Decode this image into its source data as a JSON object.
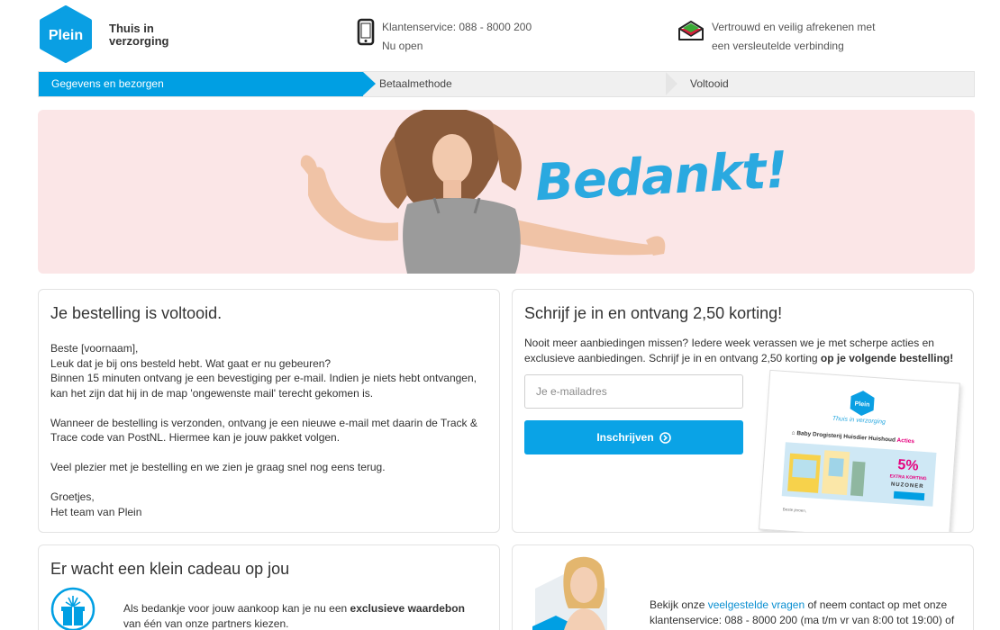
{
  "header": {
    "logo_text": "Plein",
    "tagline_line1": "Thuis in",
    "tagline_line2": "verzorging",
    "service_line1": "Klantenservice: 088 - 8000 200",
    "service_line2": "Nu open",
    "trust_line1": "Vertrouwd en veilig afrekenen met",
    "trust_line2": "een versleutelde verbinding"
  },
  "steps": [
    {
      "label": "Gegevens en bezorgen",
      "active": true
    },
    {
      "label": "Betaalmethode",
      "active": false
    },
    {
      "label": "Voltooid",
      "active": false
    }
  ],
  "banner": {
    "text": "Bedankt!"
  },
  "order_card": {
    "title": "Je bestelling is voltooid.",
    "greeting": "Beste [voornaam],",
    "line1": "Leuk dat je bij ons besteld hebt. Wat gaat er nu gebeuren?",
    "line2": "Binnen 15 minuten ontvang je een bevestiging per e-mail. Indien je niets hebt ontvangen,",
    "line3": "kan het zijn dat hij in de map 'ongewenste mail' terecht gekomen is.",
    "para2_line1": "Wanneer de bestelling is verzonden, ontvang je een nieuwe e-mail met daarin de Track &",
    "para2_line2": "Trace code van PostNL. Hiermee kan je jouw pakket volgen.",
    "para3": "Veel plezier met je bestelling en we zien je graag snel nog eens terug.",
    "closing1": "Groetjes,",
    "closing2": "Het team van Plein"
  },
  "newsletter_card": {
    "title": "Schrijf je in en ontvang 2,50 korting!",
    "desc_line1": "Nooit meer aanbiedingen missen? Iedere week verassen we je met scherpe acties en",
    "desc_line2_plain": "exclusieve aanbiedingen. Schrijf je in en ontvang 2,50 korting ",
    "desc_line2_bold": "op je volgende bestelling!",
    "email_placeholder": "Je e-mailadres",
    "subscribe_label": "Inschrijven",
    "preview": {
      "logo": "Plein",
      "tagline": "Thuis in verzorging",
      "nav": [
        "Baby",
        "Drogisterij",
        "Huisdier",
        "Huishoud"
      ],
      "nav_action": "Acties",
      "percent": "5%",
      "korting": "EXTRA KORTING",
      "code": "NUZONER",
      "body": "Beste jeroen,"
    }
  },
  "gift_card": {
    "title": "Er wacht een klein cadeau op jou",
    "text_plain": "Als bedankje voor jouw aankoop kan je nu een ",
    "text_bold": "exclusieve waardebon",
    "text_line2": "van één van onze partners kiezen."
  },
  "service_card": {
    "text_plain1": "Bekijk onze ",
    "text_link": "veelgestelde vragen",
    "text_plain2": " of neem contact op met onze",
    "text_line2": "klantenservice: 088 - 8000 200 (ma t/m vr van 8:00 tot 19:00) of"
  },
  "colors": {
    "brand": "#009fe3",
    "banner_bg": "#fbe6e7",
    "bedankt": "#2aa9e0"
  }
}
